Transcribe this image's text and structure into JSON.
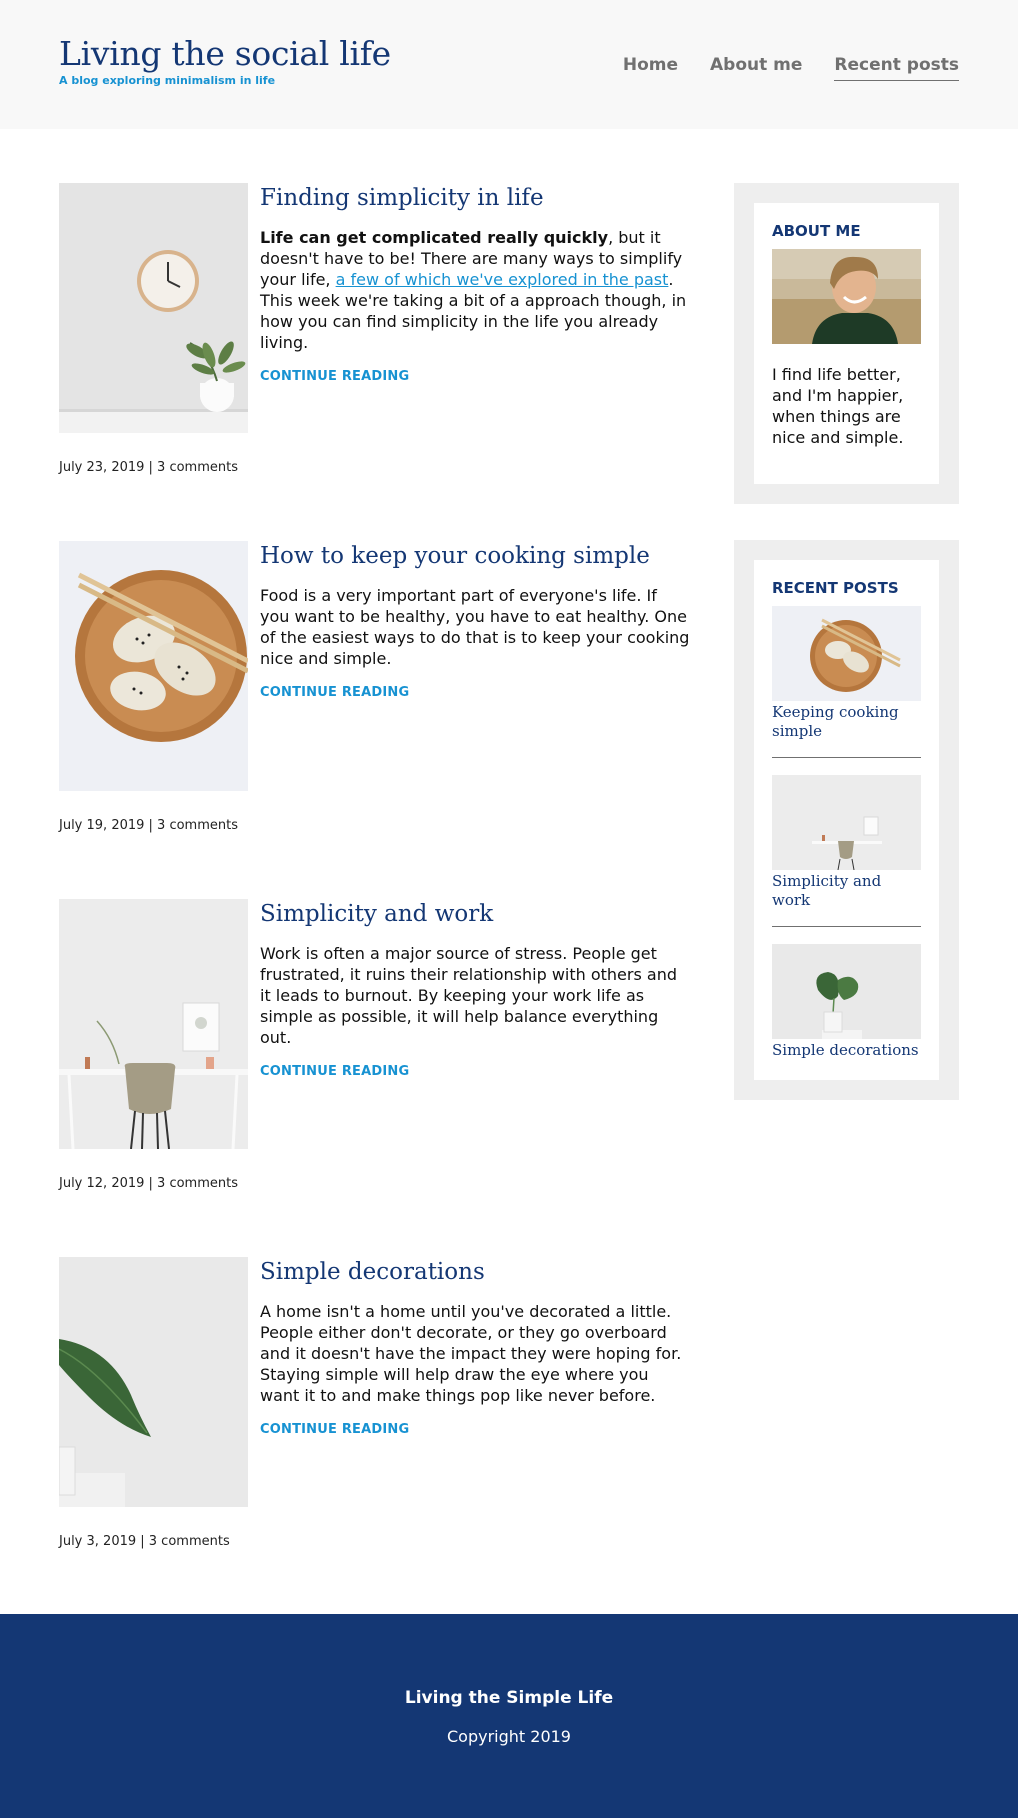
{
  "header": {
    "title": "Living the social life",
    "subtitle": "A blog exploring minimalism in life",
    "nav": [
      {
        "label": "Home"
      },
      {
        "label": "About me"
      },
      {
        "label": "Recent posts"
      }
    ]
  },
  "posts": [
    {
      "title": "Finding simplicity in life",
      "excerpt_bold": "Life can get complicated really quickly",
      "excerpt_1": ", but it doesn't have to be! There are many ways to simplify your life, ",
      "excerpt_link": "a few of which we've explored in the past",
      "excerpt_2": ". This week we're taking a bit of a approach though, in how you can find simplicity in the life you already living.",
      "read_more": "Continue reading",
      "meta": "July 23, 2019 | 3 comments"
    },
    {
      "title": "How to keep your cooking simple",
      "excerpt": "Food is a very important part of everyone's life. If you want to be healthy, you have to eat healthy. One of the easiest ways to do that is to keep your cooking nice and simple.",
      "read_more": "Continue reading",
      "meta": "July 19, 2019 | 3 comments"
    },
    {
      "title": "Simplicity and work",
      "excerpt": "Work is often a major source of stress. People get frustrated, it ruins their relationship with others and it leads to burnout. By keeping your work life as simple as possible, it will help balance everything out.",
      "read_more": "Continue reading",
      "meta": "July 12, 2019 | 3 comments"
    },
    {
      "title": "Simple decorations",
      "excerpt": "A home isn't a home until you've decorated a little. People either don't decorate, or they go overboard and it doesn't have the impact they were hoping for. Staying simple will help draw the eye where you want it to and make things pop like never before.",
      "read_more": "Continue reading",
      "meta": "July 3, 2019 | 3 comments"
    }
  ],
  "sidebar": {
    "about": {
      "title": "About me",
      "text": "I find life better, and I'm happier, when things are nice and simple."
    },
    "recent": {
      "title": "Recent posts",
      "items": [
        {
          "label": "Keeping cooking simple"
        },
        {
          "label": "Simplicity and work"
        },
        {
          "label": "Simple decorations"
        }
      ]
    }
  },
  "footer": {
    "title": "Living the Simple Life",
    "copyright": "Copyright 2019"
  },
  "colors": {
    "brand": "#143774",
    "accent": "#1792d2",
    "header_bg": "#f8f8f8",
    "widget_bg": "#eeeeee"
  },
  "icons": {
    "clock": "wall-clock-image",
    "dumplings": "dumplings-plate-image",
    "desk": "desk-chair-image",
    "plant": "leaf-vase-image",
    "portrait": "smiling-person-image"
  }
}
